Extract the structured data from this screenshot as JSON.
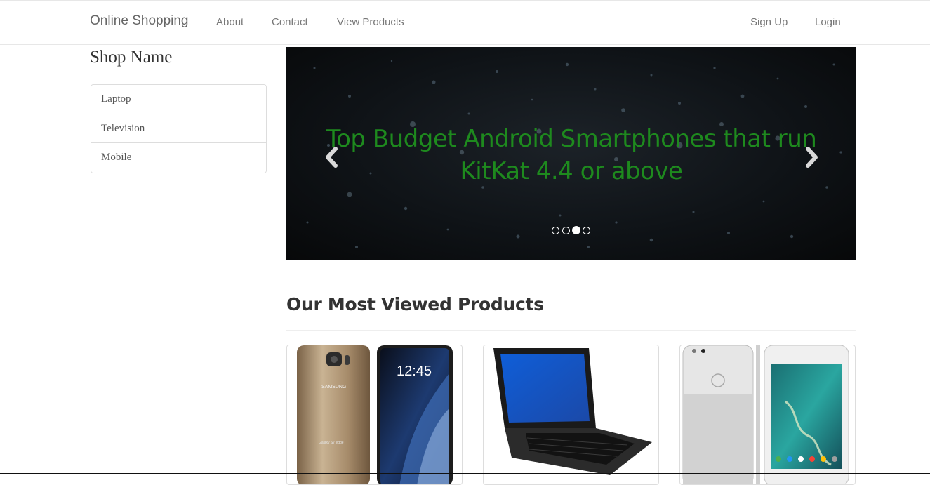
{
  "navbar": {
    "brand": "Online Shopping",
    "links": [
      "About",
      "Contact",
      "View Products"
    ],
    "right_links": [
      "Sign Up",
      "Login"
    ]
  },
  "sidebar": {
    "title": "Shop Name",
    "categories": [
      "Laptop",
      "Television",
      "Mobile"
    ]
  },
  "carousel": {
    "caption_line1": "Top Budget Android Smartphones that run",
    "caption_line2": "KitKat 4.4 or above",
    "prev_icon": "chevron-left-icon",
    "next_icon": "chevron-right-icon",
    "slide_count": 4,
    "active_index": 2,
    "caption_color": "#1e8a1e"
  },
  "products": {
    "heading": "Our Most Viewed Products",
    "items": [
      {
        "image": "samsung-galaxy-s7-edge-image",
        "phone_time": "12:45",
        "brand_text": "SAMSUNG",
        "model_text": "Galaxy S7 edge"
      },
      {
        "image": "dell-laptop-image"
      },
      {
        "image": "google-pixel-image"
      }
    ]
  }
}
